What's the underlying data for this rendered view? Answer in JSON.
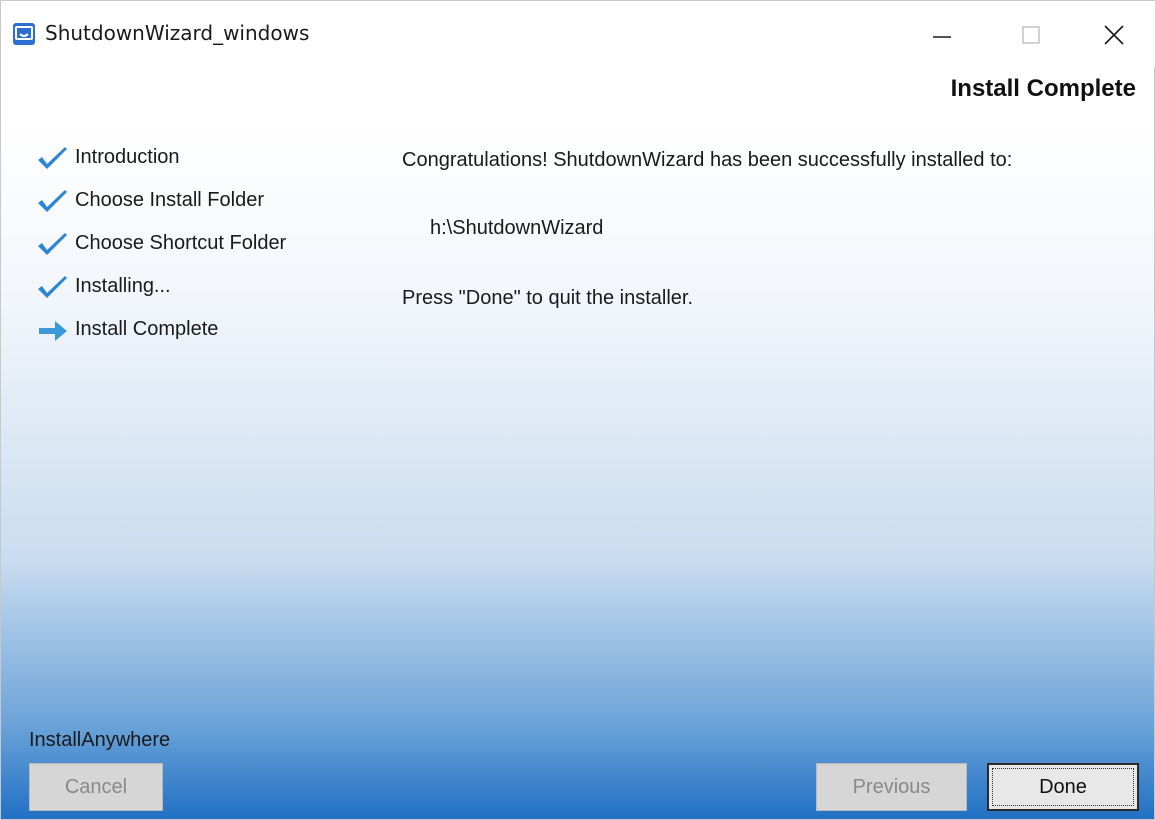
{
  "window": {
    "title": "ShutdownWizard_windows",
    "icon": "installer-app-icon",
    "controls": {
      "minimize": "minimize-icon",
      "maximize": "maximize-icon",
      "close": "close-icon"
    }
  },
  "header": {
    "title": "Install Complete"
  },
  "steps": [
    {
      "label": "Introduction",
      "state": "done",
      "icon": "checkmark-icon"
    },
    {
      "label": "Choose Install Folder",
      "state": "done",
      "icon": "checkmark-icon"
    },
    {
      "label": "Choose Shortcut Folder",
      "state": "done",
      "icon": "checkmark-icon"
    },
    {
      "label": "Installing...",
      "state": "done",
      "icon": "checkmark-icon"
    },
    {
      "label": "Install Complete",
      "state": "current",
      "icon": "arrow-right-icon"
    }
  ],
  "content": {
    "message": "Congratulations! ShutdownWizard has been successfully installed to:",
    "install_path": "h:\\ShutdownWizard",
    "instruction": "Press \"Done\" to quit the installer."
  },
  "footer": {
    "brand": "InstallAnywhere",
    "cancel_label": "Cancel",
    "previous_label": "Previous",
    "done_label": "Done"
  },
  "colors": {
    "accent": "#2d86d3",
    "arrow": "#3a9ad9",
    "gradient_bottom": "#1f6fc4"
  }
}
